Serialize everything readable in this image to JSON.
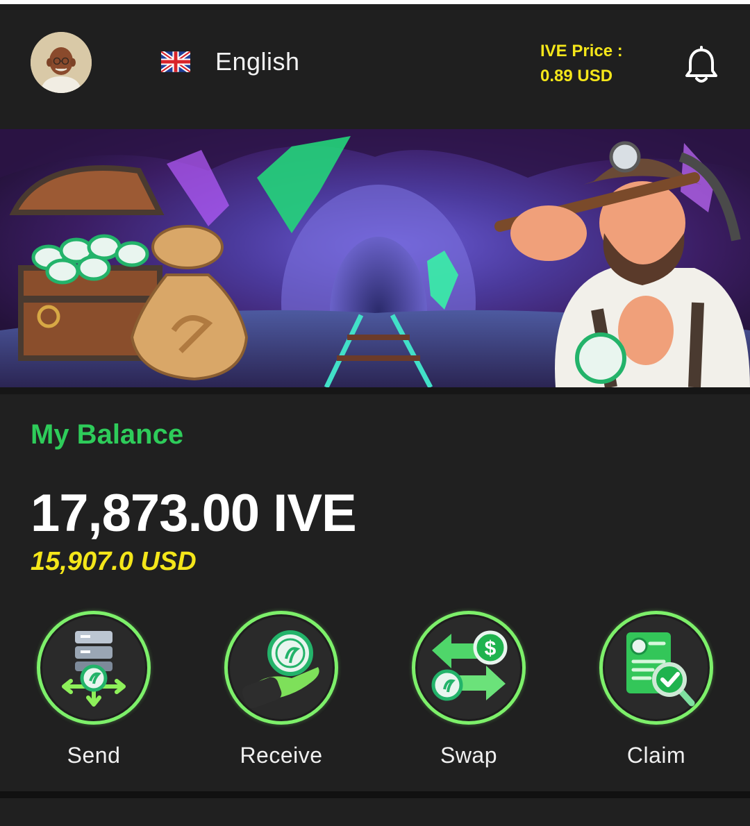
{
  "header": {
    "language": "English",
    "price_label": "IVE Price :",
    "price_value": "0.89 USD"
  },
  "icons": {
    "avatar": "user-avatar",
    "flag": "uk-flag-icon",
    "notifications": "bell-icon"
  },
  "balance": {
    "title": "My Balance",
    "amount": "17,873.00 IVE",
    "usd": "15,907.0 USD"
  },
  "actions": [
    {
      "label": "Send",
      "icon": "send-icon"
    },
    {
      "label": "Receive",
      "icon": "receive-icon"
    },
    {
      "label": "Swap",
      "icon": "swap-icon"
    },
    {
      "label": "Claim",
      "icon": "claim-icon"
    }
  ],
  "colors": {
    "accent_green": "#2ecc5a",
    "ring_green": "#7df06a",
    "price_yellow": "#f4e61a",
    "background": "#1f1f1f"
  }
}
